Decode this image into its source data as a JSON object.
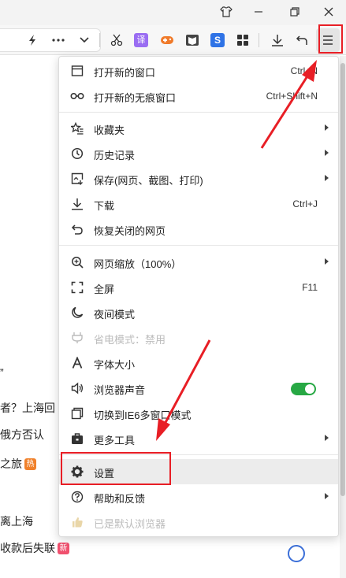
{
  "menu": {
    "items": [
      {
        "label": "打开新的窗口",
        "shortcut": "Ctrl+N",
        "icon": "new-window-icon"
      },
      {
        "label": "打开新的无痕窗口",
        "shortcut": "Ctrl+Shift+N",
        "icon": "incognito-icon"
      },
      {
        "label": "收藏夹",
        "icon": "favorites-icon"
      },
      {
        "label": "历史记录",
        "icon": "history-icon"
      },
      {
        "label": "保存(网页、截图、打印)",
        "icon": "save-icon"
      },
      {
        "label": "下载",
        "shortcut": "Ctrl+J",
        "icon": "download-icon"
      },
      {
        "label": "恢复关闭的网页",
        "icon": "restore-icon"
      },
      {
        "label": "网页缩放（100%）",
        "icon": "zoom-icon"
      },
      {
        "label": "全屏",
        "shortcut": "F11",
        "icon": "fullscreen-icon"
      },
      {
        "label": "夜间模式",
        "icon": "night-mode-icon"
      },
      {
        "label": "省电模式：禁用",
        "icon": "power-saving-icon"
      },
      {
        "label": "字体大小",
        "icon": "font-size-icon"
      },
      {
        "label": "浏览器声音",
        "icon": "sound-icon",
        "toggle_on": true
      },
      {
        "label": "切换到IE6多窗口模式",
        "icon": "ie6-mode-icon"
      },
      {
        "label": "更多工具",
        "icon": "toolbox-icon"
      },
      {
        "label": "设置",
        "icon": "gear-icon"
      },
      {
        "label": "帮助和反馈",
        "icon": "help-icon"
      },
      {
        "label": "已是默认浏览器",
        "icon": "thumb-up-icon"
      }
    ]
  },
  "background_page": {
    "lines": [
      {
        "text": "”"
      },
      {
        "text": "者？上海回"
      },
      {
        "text": "俄方否认"
      },
      {
        "text": "之旅",
        "badge": "热"
      },
      {
        "text": "离上海"
      },
      {
        "text": "收款后失联",
        "badge": "新"
      }
    ]
  },
  "colors": {
    "annotation_red": "#e81e25",
    "toggle_green": "#27a844",
    "badge_hot": "#f0812b",
    "badge_new": "#f0506e"
  }
}
